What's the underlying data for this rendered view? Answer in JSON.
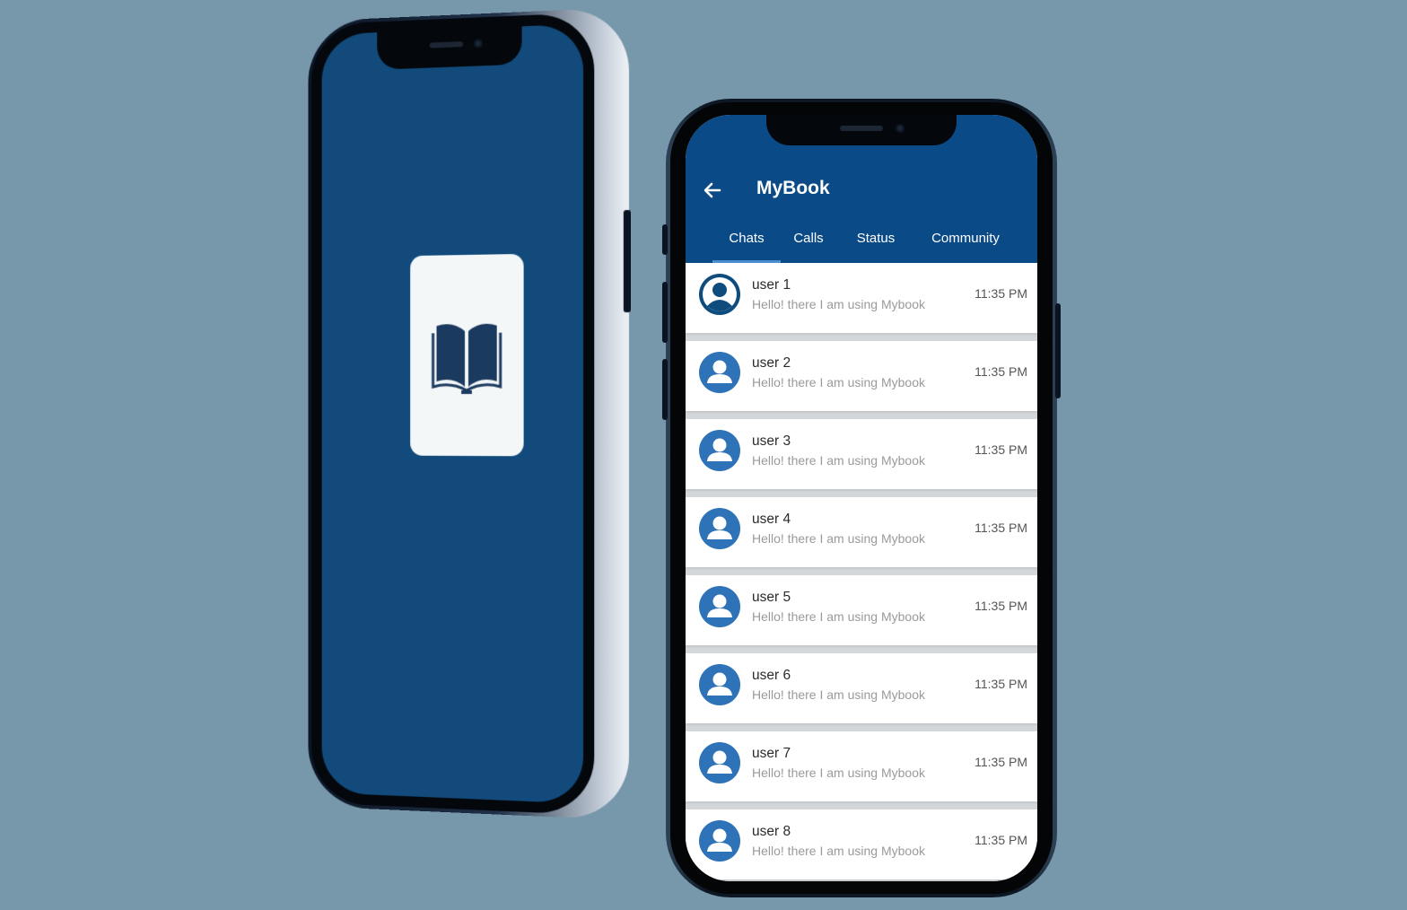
{
  "splash": {
    "logo_icon": "open-book-icon",
    "background_color": "#114a7b",
    "logo_tile_color": "#f4f7f8"
  },
  "chat_screen": {
    "back_icon": "arrow-left-icon",
    "title": "MyBook",
    "accent_color": "#0a4a86",
    "tabs": [
      {
        "label": "Chats",
        "active": true
      },
      {
        "label": "Calls",
        "active": false
      },
      {
        "label": "Status",
        "active": false
      },
      {
        "label": "Community",
        "active": false
      }
    ],
    "chats": [
      {
        "name": "user 1",
        "message": "Hello!  there I am using Mybook",
        "time": "11:35 PM",
        "avatar_icon": "person-avatar-icon"
      },
      {
        "name": "user 2",
        "message": "Hello!  there I am using Mybook",
        "time": "11:35 PM",
        "avatar_icon": "person-avatar-icon"
      },
      {
        "name": "user 3",
        "message": "Hello!  there I am using Mybook",
        "time": "11:35 PM",
        "avatar_icon": "person-avatar-icon"
      },
      {
        "name": "user 4",
        "message": "Hello!  there I am using Mybook",
        "time": "11:35 PM",
        "avatar_icon": "person-avatar-icon"
      },
      {
        "name": "user 5",
        "message": "Hello!  there I am using Mybook",
        "time": "11:35 PM",
        "avatar_icon": "person-avatar-icon"
      },
      {
        "name": "user 6",
        "message": "Hello!  there I am using Mybook",
        "time": "11:35 PM",
        "avatar_icon": "person-avatar-icon"
      },
      {
        "name": "user 7",
        "message": "Hello!  there I am using Mybook",
        "time": "11:35 PM",
        "avatar_icon": "person-avatar-icon"
      },
      {
        "name": "user 8",
        "message": "Hello!  there I am using Mybook",
        "time": "11:35 PM",
        "avatar_icon": "person-avatar-icon"
      }
    ]
  }
}
